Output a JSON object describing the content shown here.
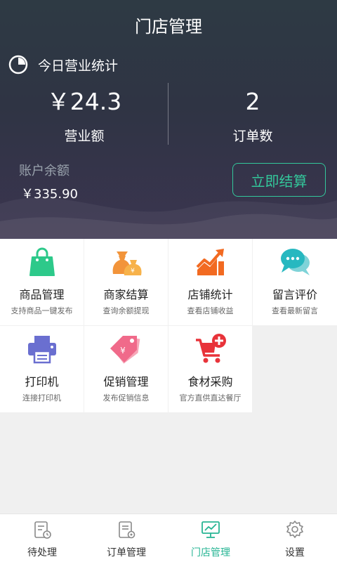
{
  "header": {
    "title": "门店管理"
  },
  "today": {
    "heading": "今日营业统计",
    "revenue_value": "￥24.3",
    "revenue_label": "营业额",
    "orders_value": "2",
    "orders_label": "订单数"
  },
  "account": {
    "balance_label": "账户余额",
    "balance_value": "￥335.90",
    "settle_button": "立即结算"
  },
  "colors": {
    "accent": "#33c79b",
    "header_bg": "#2e3a44"
  },
  "menu": [
    {
      "name": "商品管理",
      "desc": "支持商品一键发布",
      "icon": "shopping-bag-icon",
      "color": "#2dc98a"
    },
    {
      "name": "商家结算",
      "desc": "查询余额提现",
      "icon": "money-bags-icon",
      "color": "#f2943a"
    },
    {
      "name": "店铺统计",
      "desc": "查看店铺收益",
      "icon": "trend-chart-icon",
      "color": "#f26a21"
    },
    {
      "name": "留言评价",
      "desc": "查看最新留言",
      "icon": "chat-bubbles-icon",
      "color": "#27b8c0"
    },
    {
      "name": "打印机",
      "desc": "连接打印机",
      "icon": "printer-icon",
      "color": "#6a6fd0"
    },
    {
      "name": "促销管理",
      "desc": "发布促销信息",
      "icon": "price-tag-icon",
      "color": "#f06a8a"
    },
    {
      "name": "食材采购",
      "desc": "官方直供直达餐厅",
      "icon": "cart-add-icon",
      "color": "#e8333a"
    }
  ],
  "tabs": [
    {
      "label": "待处理",
      "icon": "pending-clipboard-icon"
    },
    {
      "label": "订单管理",
      "icon": "order-list-icon"
    },
    {
      "label": "门店管理",
      "icon": "store-chart-icon",
      "active": true
    },
    {
      "label": "设置",
      "icon": "gear-icon"
    }
  ]
}
